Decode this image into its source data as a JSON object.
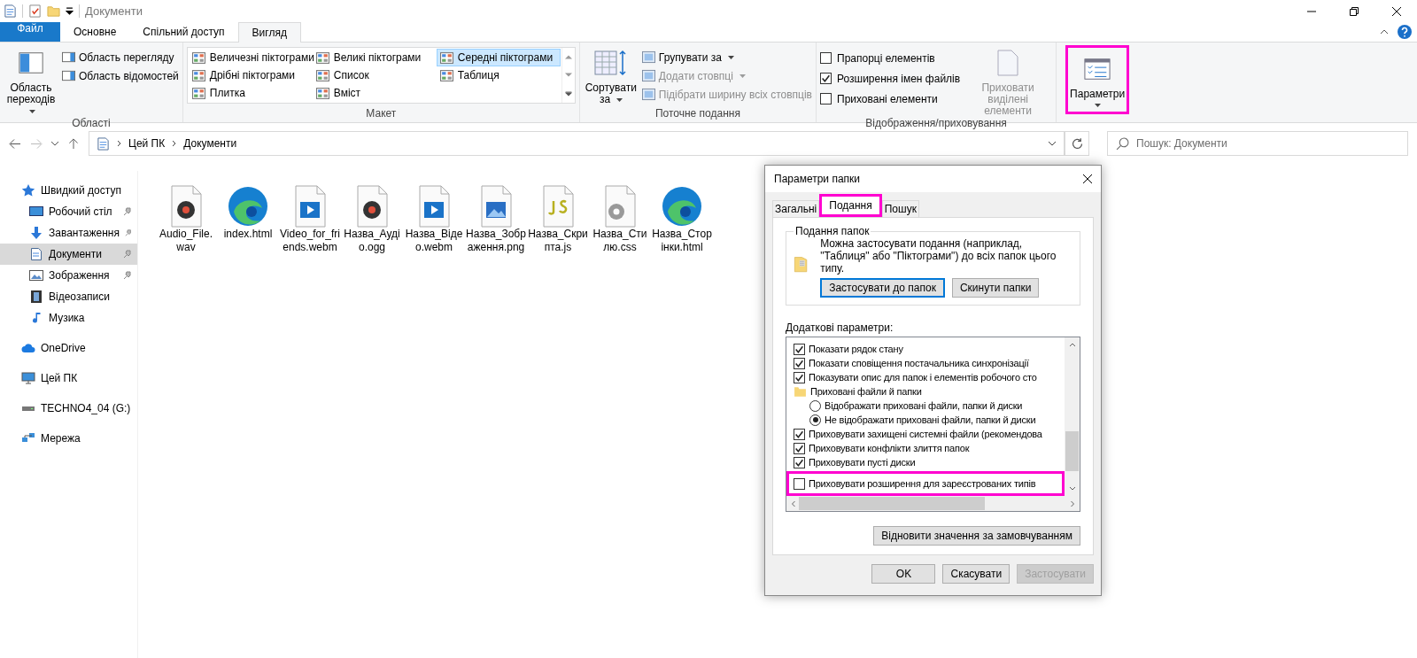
{
  "title_bar": {
    "title": "Документи"
  },
  "ribbon_tabs": [
    {
      "label": "Файл",
      "kind": "file",
      "selected": false
    },
    {
      "label": "Основне",
      "kind": "tab",
      "selected": false
    },
    {
      "label": "Спільний доступ",
      "kind": "tab",
      "selected": false
    },
    {
      "label": "Вигляд",
      "kind": "tab",
      "selected": true
    }
  ],
  "ribbon": {
    "panes": {
      "label": "Області",
      "nav_pane": "Область переходів",
      "items": [
        "Область перегляду",
        "Область відомостей"
      ]
    },
    "layout": {
      "label": "Макет",
      "options": [
        {
          "label": "Величезні піктограми",
          "selected": false
        },
        {
          "label": "Дрібні піктограми",
          "selected": false
        },
        {
          "label": "Плитка",
          "selected": false
        },
        {
          "label": "Великі піктограми",
          "selected": false
        },
        {
          "label": "Список",
          "selected": false
        },
        {
          "label": "Вміст",
          "selected": false
        },
        {
          "label": "Середні піктограми",
          "selected": true
        },
        {
          "label": "Таблиця",
          "selected": false
        }
      ]
    },
    "current_view": {
      "label": "Поточне подання",
      "sort": "Сортувати за",
      "items": [
        {
          "label": "Групувати за",
          "disabled": false
        },
        {
          "label": "Додати стовпці",
          "disabled": true
        },
        {
          "label": "Підібрати ширину всіх стовпців",
          "disabled": true
        }
      ]
    },
    "show_hide": {
      "label": "Відображення/приховування",
      "checkboxes": [
        {
          "label": "Прапорці елементів",
          "checked": false
        },
        {
          "label": "Розширення імен файлів",
          "checked": true
        },
        {
          "label": "Приховані елементи",
          "checked": false
        }
      ],
      "hide_selected": {
        "label": "Приховати виділені елементи",
        "disabled": true
      }
    },
    "options": {
      "label": "Параметри",
      "highlighted": true
    }
  },
  "address": {
    "path": [
      "Цей ПК",
      "Документи"
    ],
    "search_placeholder": "Пошук: Документи"
  },
  "sidebar": [
    {
      "label": "Швидкий доступ",
      "selected": false,
      "children": [
        {
          "label": "Робочий стіл",
          "selected": false,
          "pinned": true
        },
        {
          "label": "Завантаження",
          "selected": false,
          "pinned": true
        },
        {
          "label": "Документи",
          "selected": true,
          "pinned": true
        },
        {
          "label": "Зображення",
          "selected": false,
          "pinned": true
        },
        {
          "label": "Відеозаписи",
          "selected": false,
          "pinned": false
        },
        {
          "label": "Музика",
          "selected": false,
          "pinned": false
        }
      ]
    },
    {
      "label": "OneDrive",
      "selected": false
    },
    {
      "label": "Цей ПК",
      "selected": false
    },
    {
      "label": "TECHNO4_04 (G:)",
      "selected": false
    },
    {
      "label": "Мережа",
      "selected": false
    }
  ],
  "files": [
    {
      "name": "Audio_File.wav",
      "kind": "audio"
    },
    {
      "name": "index.html",
      "kind": "edge"
    },
    {
      "name": "Video_for_friends.webm",
      "kind": "video"
    },
    {
      "name": "Назва_Аудіо.ogg",
      "kind": "audio"
    },
    {
      "name": "Назва_Відео.webm",
      "kind": "video"
    },
    {
      "name": "Назва_Зображення.png",
      "kind": "image"
    },
    {
      "name": "Назва_Скрипта.js",
      "kind": "js"
    },
    {
      "name": "Назва_Стилю.css",
      "kind": "css"
    },
    {
      "name": "Назва_Сторінки.html",
      "kind": "edge"
    }
  ],
  "dialog": {
    "title": "Параметри папки",
    "tabs": [
      {
        "label": "Загальні",
        "selected": false,
        "highlighted": false
      },
      {
        "label": "Подання",
        "selected": true,
        "highlighted": true
      },
      {
        "label": "Пошук",
        "selected": false,
        "highlighted": false
      }
    ],
    "folder_views": {
      "label": "Подання папок",
      "description": "Можна застосувати подання (наприклад, \"Таблиця\" або \"Піктограми\") до всіх папок цього типу.",
      "buttons": [
        {
          "label": "Застосувати до папок",
          "focused": true
        },
        {
          "label": "Скинути папки",
          "focused": false
        }
      ]
    },
    "advanced_label": "Додаткові параметри:",
    "settings": [
      {
        "kind": "checkbox",
        "label": "Показати рядок стану",
        "checked": true,
        "highlighted": false
      },
      {
        "kind": "checkbox",
        "label": "Показати сповіщення постачальника синхронізації",
        "checked": true,
        "highlighted": false
      },
      {
        "kind": "checkbox",
        "label": "Показувати опис для папок і елементів робочого сто",
        "checked": true,
        "highlighted": false
      },
      {
        "kind": "folder",
        "label": "Приховані файли й папки",
        "highlighted": false,
        "children": [
          {
            "kind": "radio",
            "label": "Відображати приховані файли, папки й диски",
            "selected": false
          },
          {
            "kind": "radio",
            "label": "Не відображати приховані файли, папки й диски",
            "selected": true
          }
        ]
      },
      {
        "kind": "checkbox",
        "label": "Приховувати захищені системні файли (рекомендова",
        "checked": true,
        "highlighted": false
      },
      {
        "kind": "checkbox",
        "label": "Приховувати конфлікти злиття папок",
        "checked": true,
        "highlighted": false
      },
      {
        "kind": "checkbox",
        "label": "Приховувати пусті диски",
        "checked": true,
        "highlighted": false
      },
      {
        "kind": "checkbox",
        "label": "Приховувати розширення для зареєстрованих типів",
        "checked": false,
        "highlighted": true
      }
    ],
    "restore": "Відновити значення за замовчуванням",
    "footer": [
      {
        "label": "OK",
        "disabled": false
      },
      {
        "label": "Скасувати",
        "disabled": false
      },
      {
        "label": "Застосувати",
        "disabled": true
      }
    ]
  }
}
